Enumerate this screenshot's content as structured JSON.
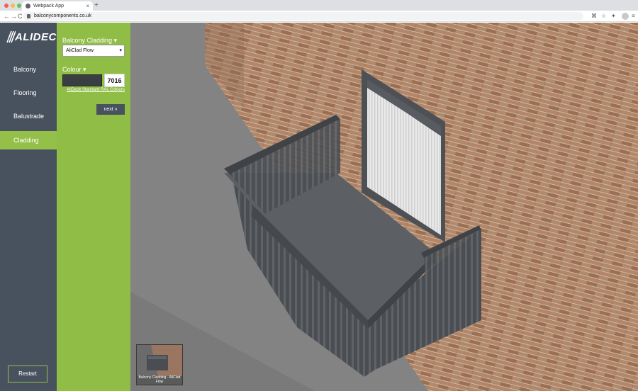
{
  "browser": {
    "tab_title": "Webpack App",
    "tab_close": "×",
    "new_tab": "+",
    "back": "←",
    "forward": "→",
    "reload": "C",
    "url": "balconycomponents.co.uk",
    "tool_icons": [
      "⌘",
      "☆",
      "✦",
      "≡"
    ],
    "colors": {
      "close": "#ee5f57",
      "minimize": "#f5bd4f",
      "maximize": "#61c454"
    }
  },
  "sidebar": {
    "logo": "ALIDECK",
    "items": [
      {
        "label": "Balcony"
      },
      {
        "label": "Flooring"
      },
      {
        "label": "Balustrade"
      },
      {
        "label": "Cladding",
        "active": true
      }
    ],
    "restart_label": "Restart"
  },
  "panel": {
    "cladding_heading": "Balcony Cladding ▾",
    "cladding_value": "AliClad Flow",
    "colour_heading": "Colour ▾",
    "colour_code": "7016",
    "colour_hex": "#383e42",
    "ral_link": "AliDeck Standard RAL Colours",
    "next_label": "next »"
  },
  "viewport": {
    "thumbnail_caption": "Balcony Cladding - AliClad Flow"
  },
  "colors": {
    "accent": "#8fbd46",
    "sidebar": "#48525e",
    "brick": "#a7795a",
    "steel": "#4d5055"
  }
}
